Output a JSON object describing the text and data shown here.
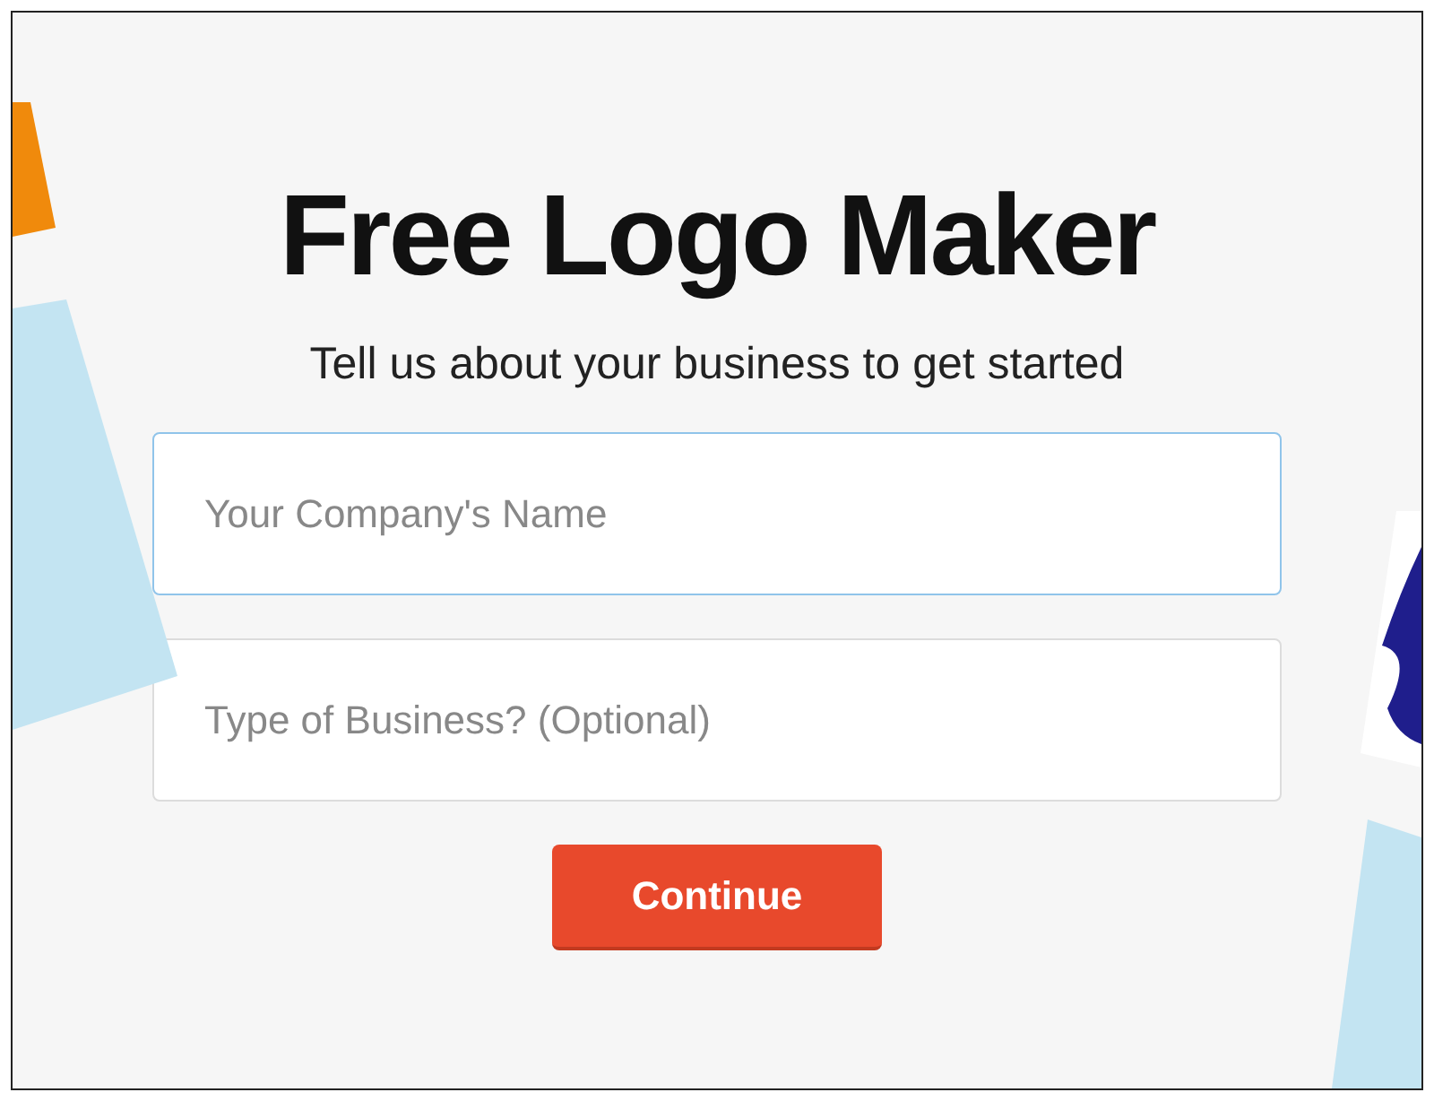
{
  "title": "Free Logo Maker",
  "subtitle": "Tell us about your business to get started",
  "fields": [
    {
      "placeholder": "Your Company's Name",
      "focused": true
    },
    {
      "placeholder": "Type of Business? (Optional)",
      "focused": false
    }
  ],
  "button": "Continue"
}
